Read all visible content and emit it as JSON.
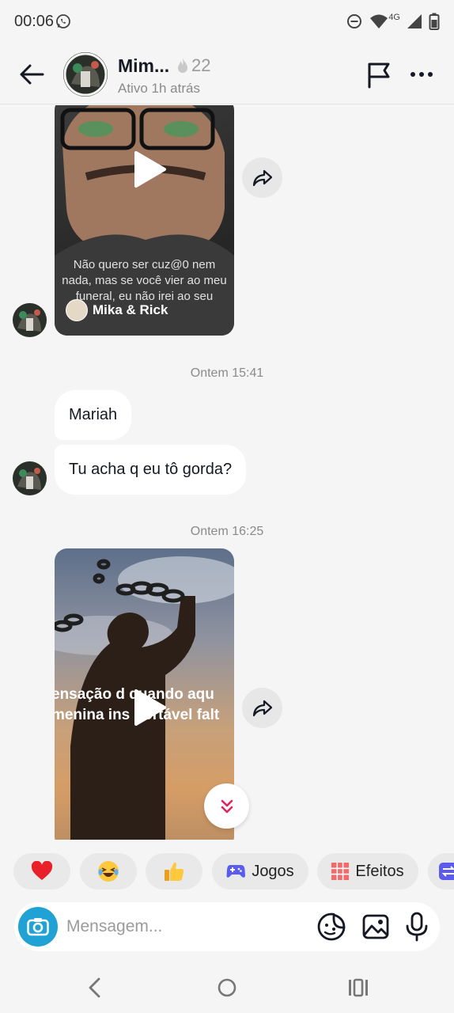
{
  "status_bar": {
    "time": "00:06",
    "network": "4G",
    "icons": [
      "whatsapp-icon",
      "do-not-disturb-icon",
      "wifi-icon",
      "signal-icon",
      "battery-icon"
    ]
  },
  "header": {
    "name": "Mim...",
    "streak_count": "22",
    "status": "Ativo 1h atrás",
    "icons": [
      "back-arrow-icon",
      "flag-icon",
      "more-icon"
    ]
  },
  "chat": {
    "video1": {
      "caption": "Não quero ser cuz@0 nem nada, mas se você vier ao meu funeral, eu não irei ao seu",
      "author": "Mika & Rick"
    },
    "timestamp1": "Ontem 15:41",
    "message1": "Mariah",
    "message2": "Tu acha q eu tô gorda?",
    "timestamp2": "Ontem 16:25",
    "video2": {
      "caption_line1": "ensação d   quando aqu",
      "caption_line2": "menina ins  portável falt"
    }
  },
  "quick_replies": [
    {
      "label": "",
      "icon": "heart-emoji"
    },
    {
      "label": "",
      "icon": "laughing-emoji"
    },
    {
      "label": "",
      "icon": "thumbs-up-emoji"
    },
    {
      "label": "Jogos",
      "icon": "gamepad-icon"
    },
    {
      "label": "Efeitos",
      "icon": "effects-grid-icon"
    }
  ],
  "composer": {
    "placeholder": "Mensagem...",
    "icons": [
      "camera-icon",
      "sticker-icon",
      "image-icon",
      "microphone-icon"
    ]
  },
  "colors": {
    "background": "#f5f5f5",
    "camera_button": "#20a3d4",
    "scroll_down_chevron": "#e0245e"
  }
}
